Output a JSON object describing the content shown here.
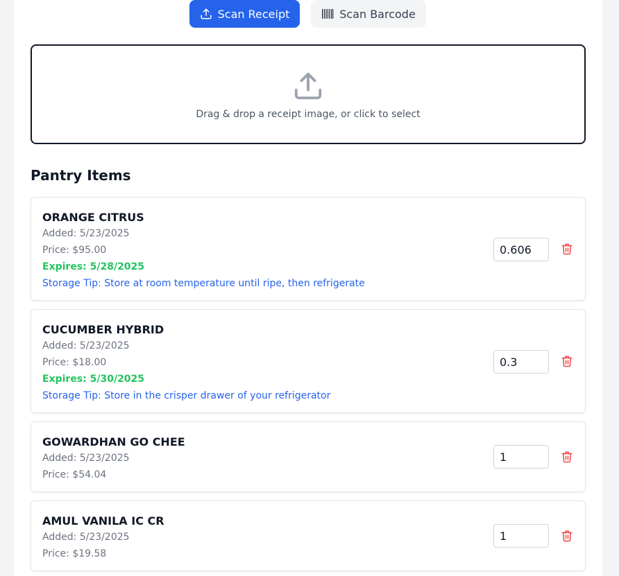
{
  "tabs": {
    "receipt_label": "Scan Receipt",
    "barcode_label": "Scan Barcode"
  },
  "dropzone": {
    "text": "Drag & drop a receipt image, or click to select"
  },
  "section_title": "Pantry Items",
  "items": [
    {
      "name": "ORANGE CITRUS",
      "added": "Added: 5/23/2025",
      "price": "Price: $95.00",
      "expires": "Expires: 5/28/2025",
      "tip": "Storage Tip: Store at room temperature until ripe, then refrigerate",
      "quantity": "0.606"
    },
    {
      "name": "CUCUMBER HYBRID",
      "added": "Added: 5/23/2025",
      "price": "Price: $18.00",
      "expires": "Expires: 5/30/2025",
      "tip": "Storage Tip: Store in the crisper drawer of your refrigerator",
      "quantity": "0.3"
    },
    {
      "name": "GOWARDHAN GO CHEE",
      "added": "Added: 5/23/2025",
      "price": "Price: $54.04",
      "quantity": "1"
    },
    {
      "name": "AMUL VANILA IC CR",
      "added": "Added: 5/23/2025",
      "price": "Price: $19.58",
      "quantity": "1"
    }
  ],
  "colors": {
    "primary": "#2563eb",
    "expires": "#22c55e",
    "tip": "#2563eb",
    "delete": "#ef4444"
  },
  "icons": {
    "receipt_tab": "upload-icon",
    "barcode_tab": "barcode-icon",
    "dropzone": "upload-icon",
    "delete": "trash-icon"
  }
}
